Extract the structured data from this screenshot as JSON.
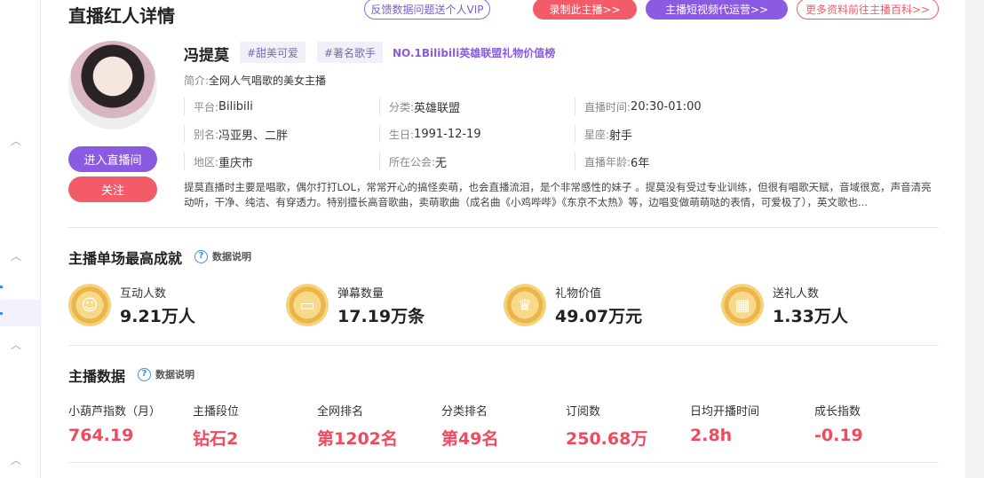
{
  "header": {
    "title": "直播红人详情",
    "buttons": [
      "反馈数据问题送个人VIP",
      "录制此主播>>",
      "主播短视频代运营>>",
      "更多资料前往主播百科>>"
    ]
  },
  "profile": {
    "name": "冯提莫",
    "tags": [
      "#甜美可爱",
      "#著名歌手"
    ],
    "rank": "NO.1Bilibili英雄联盟礼物价值榜",
    "intro_label": "简介:",
    "intro": "全网人气唱歌的美女主播",
    "enter_button": "进入直播间",
    "follow_button": "关注",
    "info": [
      {
        "label": "平台:",
        "value": "Bilibili"
      },
      {
        "label": "分类:",
        "value": "英雄联盟"
      },
      {
        "label": "直播时间:",
        "value": "20:30-01:00"
      },
      {
        "label": "别名:",
        "value": "冯亚男、二胖"
      },
      {
        "label": "生日:",
        "value": "1991-12-19"
      },
      {
        "label": "星座:",
        "value": "射手"
      },
      {
        "label": "地区:",
        "value": "重庆市"
      },
      {
        "label": "所在公会:",
        "value": "无"
      },
      {
        "label": "直播年龄:",
        "value": "6年"
      }
    ],
    "description": "提莫直播时主要是唱歌，偶尔打打LOL，常常开心的搞怪卖萌，也会直播流泪，是个非常感性的妹子 。提莫没有受过专业训练，但很有唱歌天赋，音域很宽，声音清亮动听，干净、纯洁、有穿透力。特别擅长高音歌曲，卖萌歌曲（成名曲《小鸡哔哔》《东京不太热》等，边唱变做萌萌哒的表情，可爱极了），英文歌也..."
  },
  "achievements": {
    "title": "主播单场最高成就",
    "help": "数据说明",
    "items": [
      {
        "label": "互动人数",
        "value": "9.21万人",
        "icon": "people-medal-icon"
      },
      {
        "label": "弹幕数量",
        "value": "17.19万条",
        "icon": "chat-medal-icon"
      },
      {
        "label": "礼物价值",
        "value": "49.07万元",
        "icon": "crown-medal-icon"
      },
      {
        "label": "送礼人数",
        "value": "1.33万人",
        "icon": "gift-medal-icon"
      }
    ]
  },
  "stats": {
    "title": "主播数据",
    "help": "数据说明",
    "items": [
      {
        "label": "小葫芦指数（月）",
        "value": "764.19"
      },
      {
        "label": "主播段位",
        "value": "钻石2"
      },
      {
        "label": "全网排名",
        "value": "第1202名"
      },
      {
        "label": "分类排名",
        "value": "第49名"
      },
      {
        "label": "订阅数",
        "value": "250.68万"
      },
      {
        "label": "日均开播时间",
        "value": "2.8h"
      },
      {
        "label": "成长指数",
        "value": "-0.19"
      }
    ]
  }
}
